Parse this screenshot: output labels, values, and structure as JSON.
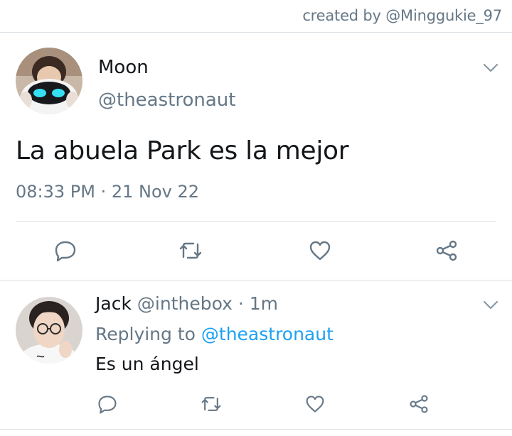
{
  "credit": "created by @Minggukie_97",
  "tweet": {
    "name": "Moon",
    "handle": "@theastronaut",
    "text": "La abuela Park es la mejor",
    "timestamp": "08:33 PM · 21 Nov 22",
    "actions": [
      "reply-icon",
      "retweet-icon",
      "like-icon",
      "share-icon"
    ]
  },
  "reply": {
    "name": "Jack",
    "handle": "@inthebox",
    "separator": " · ",
    "time": "1m",
    "replying_prefix": "Replying to ",
    "replying_to": "@theastronaut",
    "text": "Es un ángel",
    "actions": [
      "reply-icon",
      "retweet-icon",
      "like-icon",
      "share-icon"
    ]
  },
  "colors": {
    "text": "#14171a",
    "muted": "#657786",
    "link": "#1da1f2",
    "divider": "#d8dfe3"
  }
}
